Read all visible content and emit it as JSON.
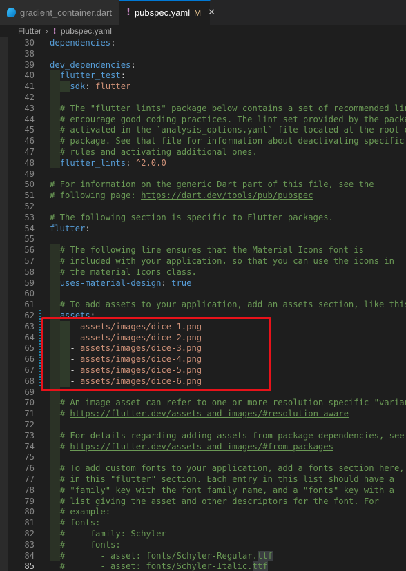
{
  "tabs": [
    {
      "label": "gradient_container.dart",
      "icon": "dart-icon",
      "active": false
    },
    {
      "label": "pubspec.yaml",
      "icon": "yaml-icon",
      "active": true,
      "modified": "M",
      "close": "✕"
    }
  ],
  "breadcrumb": {
    "folder": "Flutter",
    "separator": "›",
    "file_icon": "!",
    "file": "pubspec.yaml"
  },
  "editor": {
    "current_line": "85",
    "lines": [
      {
        "num": "30",
        "parts": [
          [
            "k",
            "dependencies"
          ],
          [
            "p",
            ":"
          ]
        ]
      },
      {
        "num": "38",
        "parts": []
      },
      {
        "num": "39",
        "parts": [
          [
            "k",
            "dev_dependencies"
          ],
          [
            "p",
            ":"
          ]
        ]
      },
      {
        "num": "40",
        "parts": [
          [
            "p",
            "  "
          ],
          [
            "k",
            "flutter_test"
          ],
          [
            "p",
            ":"
          ]
        ]
      },
      {
        "num": "41",
        "parts": [
          [
            "p",
            "    "
          ],
          [
            "k",
            "sdk"
          ],
          [
            "p",
            ": "
          ],
          [
            "s",
            "flutter"
          ]
        ]
      },
      {
        "num": "42",
        "parts": []
      },
      {
        "num": "43",
        "parts": [
          [
            "p",
            "  "
          ],
          [
            "c",
            "# The \"flutter_lints\" package below contains a set of recommended lint"
          ]
        ]
      },
      {
        "num": "44",
        "parts": [
          [
            "p",
            "  "
          ],
          [
            "c",
            "# encourage good coding practices. The lint set provided by the package"
          ]
        ]
      },
      {
        "num": "45",
        "parts": [
          [
            "p",
            "  "
          ],
          [
            "c",
            "# activated in the `analysis_options.yaml` file located at the root of"
          ]
        ]
      },
      {
        "num": "46",
        "parts": [
          [
            "p",
            "  "
          ],
          [
            "c",
            "# package. See that file for information about deactivating specific l"
          ]
        ]
      },
      {
        "num": "47",
        "parts": [
          [
            "p",
            "  "
          ],
          [
            "c",
            "# rules and activating additional ones."
          ]
        ]
      },
      {
        "num": "48",
        "parts": [
          [
            "p",
            "  "
          ],
          [
            "k",
            "flutter_lints"
          ],
          [
            "p",
            ": "
          ],
          [
            "s",
            "^2.0.0"
          ]
        ]
      },
      {
        "num": "49",
        "parts": []
      },
      {
        "num": "50",
        "parts": [
          [
            "c",
            "# For information on the generic Dart part of this file, see the"
          ]
        ]
      },
      {
        "num": "51",
        "parts": [
          [
            "c",
            "# following page: "
          ],
          [
            "u",
            "https://dart.dev/tools/pub/pubspec"
          ]
        ]
      },
      {
        "num": "52",
        "parts": []
      },
      {
        "num": "53",
        "parts": [
          [
            "c",
            "# The following section is specific to Flutter packages."
          ]
        ]
      },
      {
        "num": "54",
        "parts": [
          [
            "k",
            "flutter"
          ],
          [
            "p",
            ":"
          ]
        ]
      },
      {
        "num": "55",
        "parts": []
      },
      {
        "num": "56",
        "parts": [
          [
            "p",
            "  "
          ],
          [
            "c",
            "# The following line ensures that the Material Icons font is"
          ]
        ]
      },
      {
        "num": "57",
        "parts": [
          [
            "p",
            "  "
          ],
          [
            "c",
            "# included with your application, so that you can use the icons in"
          ]
        ]
      },
      {
        "num": "58",
        "parts": [
          [
            "p",
            "  "
          ],
          [
            "c",
            "# the material Icons class."
          ]
        ]
      },
      {
        "num": "59",
        "parts": [
          [
            "p",
            "  "
          ],
          [
            "k",
            "uses-material-design"
          ],
          [
            "p",
            ": "
          ],
          [
            "k",
            "true"
          ]
        ]
      },
      {
        "num": "60",
        "parts": []
      },
      {
        "num": "61",
        "parts": [
          [
            "p",
            "  "
          ],
          [
            "c",
            "# To add assets to your application, add an assets section, like this:"
          ]
        ]
      },
      {
        "num": "62",
        "parts": [
          [
            "p",
            "  "
          ],
          [
            "k",
            "assets"
          ],
          [
            "p",
            ":"
          ]
        ]
      },
      {
        "num": "63",
        "parts": [
          [
            "p",
            "    - "
          ],
          [
            "s",
            "assets/images/dice-1.png"
          ]
        ]
      },
      {
        "num": "64",
        "parts": [
          [
            "p",
            "    - "
          ],
          [
            "s",
            "assets/images/dice-2.png"
          ]
        ]
      },
      {
        "num": "65",
        "parts": [
          [
            "p",
            "    - "
          ],
          [
            "s",
            "assets/images/dice-3.png"
          ]
        ]
      },
      {
        "num": "66",
        "parts": [
          [
            "p",
            "    - "
          ],
          [
            "s",
            "assets/images/dice-4.png"
          ]
        ]
      },
      {
        "num": "67",
        "parts": [
          [
            "p",
            "    - "
          ],
          [
            "s",
            "assets/images/dice-5.png"
          ]
        ]
      },
      {
        "num": "68",
        "parts": [
          [
            "p",
            "    - "
          ],
          [
            "s",
            "assets/images/dice-6.png"
          ]
        ]
      },
      {
        "num": "69",
        "parts": []
      },
      {
        "num": "70",
        "parts": [
          [
            "p",
            "  "
          ],
          [
            "c",
            "# An image asset can refer to one or more resolution-specific \"variant"
          ]
        ]
      },
      {
        "num": "71",
        "parts": [
          [
            "p",
            "  "
          ],
          [
            "c",
            "# "
          ],
          [
            "u",
            "https://flutter.dev/assets-and-images/#resolution-aware"
          ]
        ]
      },
      {
        "num": "72",
        "parts": []
      },
      {
        "num": "73",
        "parts": [
          [
            "p",
            "  "
          ],
          [
            "c",
            "# For details regarding adding assets from package dependencies, see"
          ]
        ]
      },
      {
        "num": "74",
        "parts": [
          [
            "p",
            "  "
          ],
          [
            "c",
            "# "
          ],
          [
            "u",
            "https://flutter.dev/assets-and-images/#from-packages"
          ]
        ]
      },
      {
        "num": "75",
        "parts": []
      },
      {
        "num": "76",
        "parts": [
          [
            "p",
            "  "
          ],
          [
            "c",
            "# To add custom fonts to your application, add a fonts section here,"
          ]
        ]
      },
      {
        "num": "77",
        "parts": [
          [
            "p",
            "  "
          ],
          [
            "c",
            "# in this \"flutter\" section. Each entry in this list should have a"
          ]
        ]
      },
      {
        "num": "78",
        "parts": [
          [
            "p",
            "  "
          ],
          [
            "c",
            "# \"family\" key with the font family name, and a \"fonts\" key with a"
          ]
        ]
      },
      {
        "num": "79",
        "parts": [
          [
            "p",
            "  "
          ],
          [
            "c",
            "# list giving the asset and other descriptors for the font. For"
          ]
        ]
      },
      {
        "num": "80",
        "parts": [
          [
            "p",
            "  "
          ],
          [
            "c",
            "# example:"
          ]
        ]
      },
      {
        "num": "81",
        "parts": [
          [
            "p",
            "  "
          ],
          [
            "c",
            "# fonts:"
          ]
        ]
      },
      {
        "num": "82",
        "parts": [
          [
            "p",
            "  "
          ],
          [
            "c",
            "#   - family: Schyler"
          ]
        ]
      },
      {
        "num": "83",
        "parts": [
          [
            "p",
            "  "
          ],
          [
            "c",
            "#     fonts:"
          ]
        ]
      },
      {
        "num": "84",
        "parts": [
          [
            "p",
            "  "
          ],
          [
            "c",
            "#       - asset: fonts/Schyler-Regular."
          ],
          [
            "hl",
            "ttf"
          ]
        ]
      },
      {
        "num": "85",
        "parts": [
          [
            "p",
            "  "
          ],
          [
            "c",
            "#       - asset: fonts/Schyler-Italic."
          ],
          [
            "hl",
            "ttf"
          ]
        ]
      }
    ]
  },
  "colors": {
    "highlight_box": "#e8121a",
    "keyword": "#569cd6",
    "string": "#ce9178",
    "comment": "#6a9955"
  }
}
